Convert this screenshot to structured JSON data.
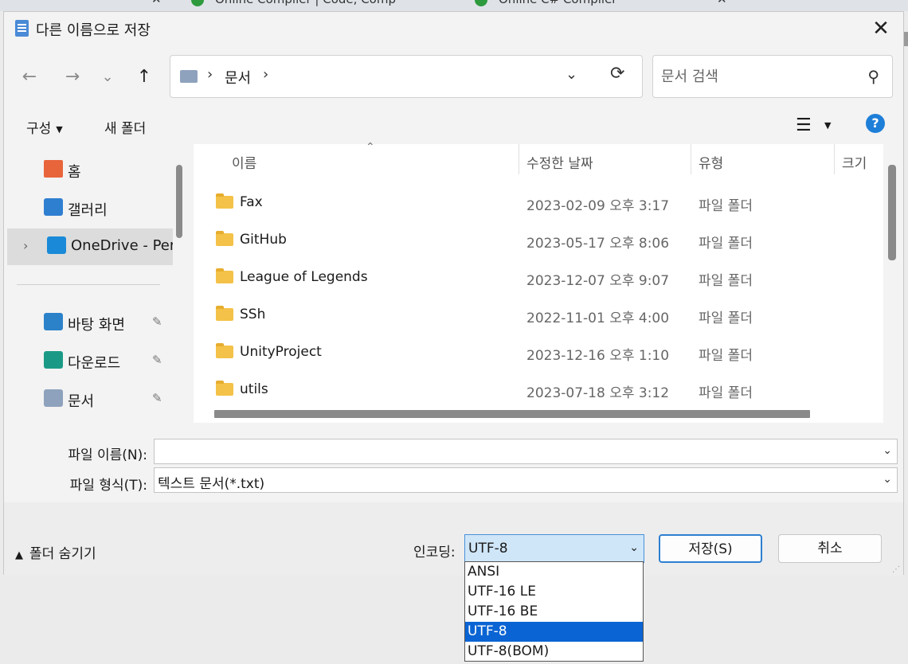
{
  "browser_tabs": [
    {
      "label": "Online Compiler | Code, Comp"
    },
    {
      "label": "Online C# Compiler"
    }
  ],
  "dialog": {
    "title": "다른 이름으로 저장",
    "close_glyph": "✕"
  },
  "navigation": {
    "back_glyph": "←",
    "forward_glyph": "→",
    "recent_glyph": "⌄",
    "up_glyph": "↑",
    "address_crumb": "문서",
    "address_sep": "›",
    "address_dropdown_glyph": "⌄",
    "refresh_glyph": "⟳",
    "search_placeholder": "문서 검색",
    "search_glyph": "⚲"
  },
  "command_bar": {
    "organize_label": "구성",
    "new_folder_label": "새 폴더",
    "view_glyph": "☰",
    "help_glyph": "?"
  },
  "sidebar": {
    "items": [
      {
        "label": "홈",
        "icon": "home-icon",
        "color": "#e8643a"
      },
      {
        "label": "갤러리",
        "icon": "gallery-icon",
        "color": "#2f7fd1"
      },
      {
        "label": "OneDrive - Pers",
        "icon": "onedrive-icon",
        "color": "#1a8ad8"
      },
      {
        "label": "바탕 화면",
        "icon": "desktop-icon",
        "color": "#2c82c9"
      },
      {
        "label": "다운로드",
        "icon": "download-icon",
        "color": "#1a9a86"
      },
      {
        "label": "문서",
        "icon": "documents-icon",
        "color": "#8ea2bd"
      }
    ],
    "pin_glyph": "📌",
    "chevron_glyph": "›"
  },
  "file_list": {
    "columns": [
      "이름",
      "수정한 날짜",
      "유형",
      "크기"
    ],
    "rows": [
      {
        "name": "Fax",
        "date": "2023-02-09 오후 3:17",
        "type": "파일 폴더"
      },
      {
        "name": "GitHub",
        "date": "2023-05-17 오후 8:06",
        "type": "파일 폴더"
      },
      {
        "name": "League of Legends",
        "date": "2023-12-07 오후 9:07",
        "type": "파일 폴더"
      },
      {
        "name": "SSh",
        "date": "2022-11-01 오후 4:00",
        "type": "파일 폴더"
      },
      {
        "name": "UnityProject",
        "date": "2023-12-16 오후 1:10",
        "type": "파일 폴더"
      },
      {
        "name": "utils",
        "date": "2023-07-18 오후 3:12",
        "type": "파일 폴더"
      }
    ]
  },
  "form": {
    "filename_label": "파일 이름(N):",
    "filename_value": "",
    "filetype_label": "파일 형식(T):",
    "filetype_value": "텍스트 문서(*.txt)"
  },
  "footer": {
    "hide_folders_label": "폴더 숨기기",
    "encoding_label": "인코딩:",
    "encoding_value": "UTF-8",
    "save_label": "저장(S)",
    "cancel_label": "취소"
  },
  "encoding_options": [
    "ANSI",
    "UTF-16 LE",
    "UTF-16 BE",
    "UTF-8",
    "UTF-8(BOM)"
  ],
  "encoding_selected_index": 3,
  "colors": {
    "accent": "#0a64d3",
    "help": "#1e7fd8",
    "folder": "#f4c248"
  }
}
